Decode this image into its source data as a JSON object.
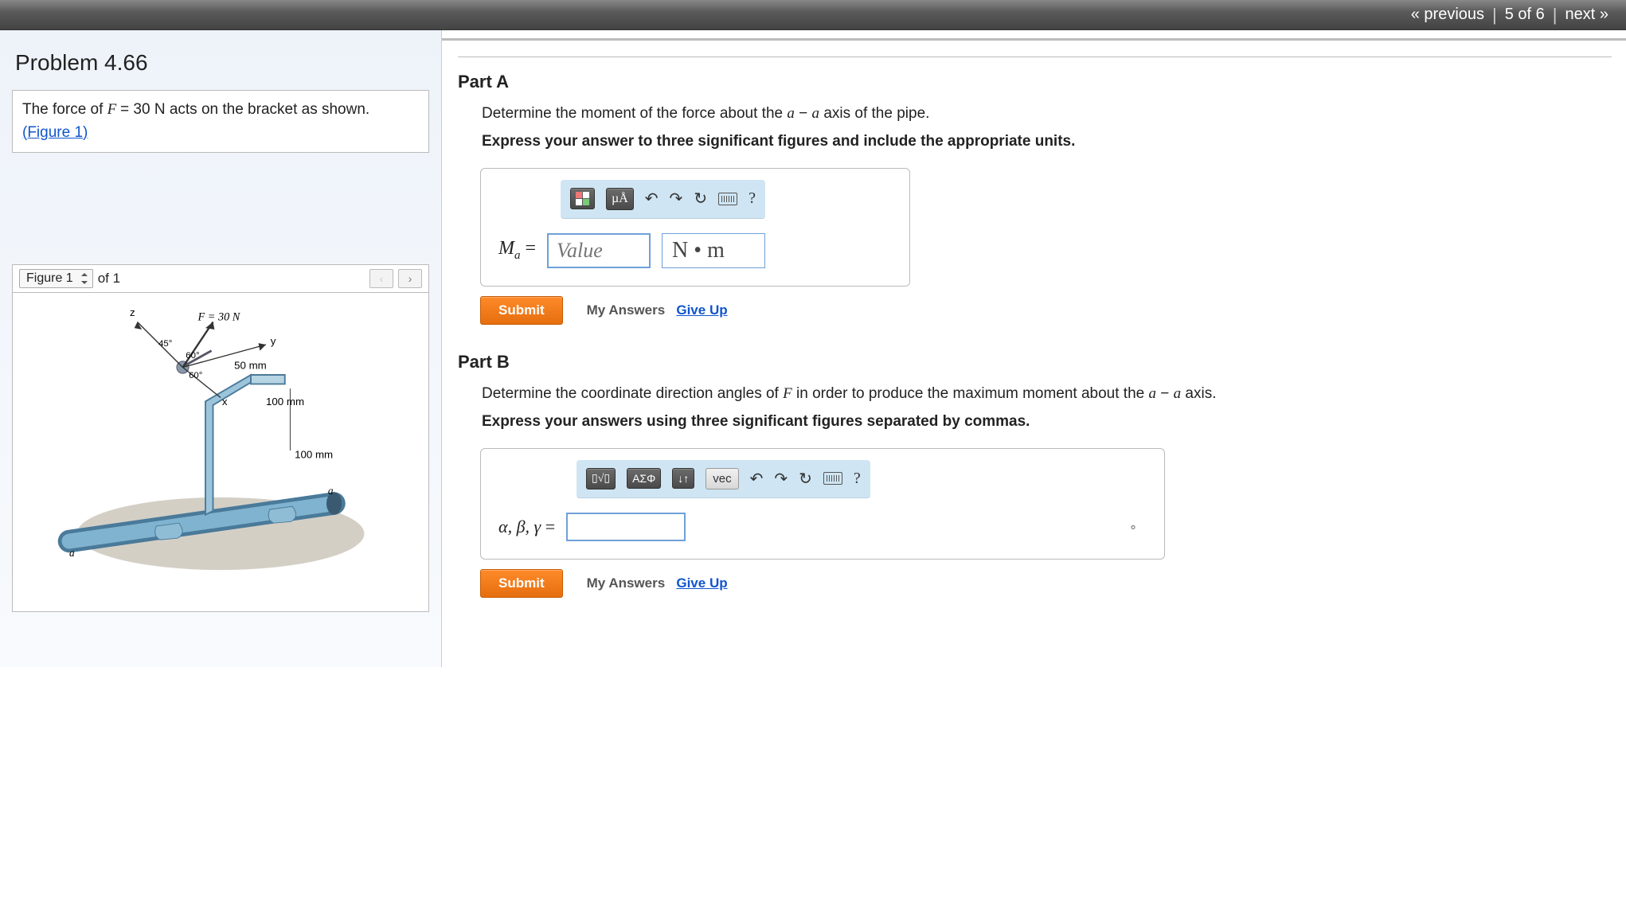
{
  "nav": {
    "prev": "« previous",
    "counter": "5 of 6",
    "next": "next »"
  },
  "problem": {
    "title": "Problem 4.66",
    "desc_before": "The force of ",
    "force_expr": "F = 30 N",
    "desc_after": " acts on the bracket as shown.",
    "figure_link": "(Figure 1)"
  },
  "figure": {
    "selector": "Figure 1",
    "of_label": "of 1",
    "labels": {
      "F": "F = 30 N",
      "ang45": "45°",
      "ang60a": "60°",
      "ang60b": "60°",
      "d50": "50 mm",
      "d100a": "100 mm",
      "d100b": "100 mm",
      "z": "z",
      "y": "y",
      "x": "x",
      "a1": "a",
      "a2": "a"
    }
  },
  "partA": {
    "title": "Part A",
    "prompt_pre": "Determine the moment of the force about the ",
    "a1": "a",
    "dash": " − ",
    "a2": "a",
    "prompt_post": " axis of the pipe.",
    "instruction": "Express your answer to three significant figures and include the appropriate units.",
    "eq_label_html": "Mₐ =",
    "value_placeholder": "Value",
    "units_text": "N • m",
    "submit": "Submit",
    "my_answers": "My Answers",
    "give_up": "Give Up",
    "toolbar": {
      "muA": "µÅ",
      "tmpl": "▯▯",
      "help": "?"
    }
  },
  "partB": {
    "title": "Part B",
    "prompt_pre": "Determine the coordinate direction angles of ",
    "F": "F",
    "prompt_mid": " in order to produce the maximum moment about the ",
    "a1": "a",
    "dash": " − ",
    "a2": "a",
    "prompt_post": " axis.",
    "instruction": "Express your answers using three significant figures separated by commas.",
    "eq_label": "α, β, γ =",
    "submit": "Submit",
    "my_answers": "My Answers",
    "give_up": "Give Up",
    "toolbar": {
      "tmpl": "▯√▯",
      "greek": "ΑΣΦ",
      "updown": "↓↑",
      "vec": "vec",
      "help": "?"
    }
  }
}
